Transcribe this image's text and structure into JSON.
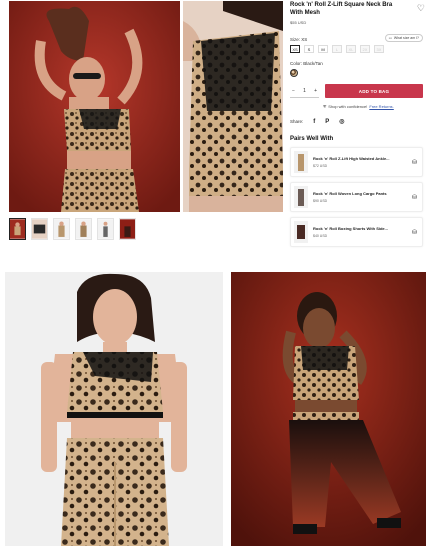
{
  "product": {
    "title": "Rock 'n' Roll Z-Lift Square Neck Bra With Mesh",
    "price": "$55 USD",
    "wishlist_icon": "heart-icon"
  },
  "size": {
    "label": "Size: XS",
    "guide_label": "What size am I?",
    "options": [
      "XS",
      "S",
      "M",
      "L",
      "XL",
      "2X",
      "3X"
    ],
    "selected": "XS"
  },
  "color": {
    "label": "Color: Black/Tan",
    "swatch": "leopard"
  },
  "cart": {
    "quantity": "1",
    "minus": "−",
    "plus": "+",
    "add_label": "ADD TO BAG",
    "accent": "#c8364c"
  },
  "confidence": {
    "text": "Shop with confidence!",
    "link": "Free Returns."
  },
  "share": {
    "label": "Share:",
    "icons": [
      "f",
      "P",
      "◎"
    ]
  },
  "pairs": {
    "title": "Pairs Well With",
    "items": [
      {
        "name": "Rock 'n' Roll Z-Lift High Waisted Ankle...",
        "price": "$72 USD"
      },
      {
        "name": "Rock 'n' Roll Woven Long Cargo Pants",
        "price": "$90 USD"
      },
      {
        "name": "Rock 'n' Roll Boxing Shorts With Side...",
        "price": "$40 USD"
      }
    ]
  }
}
